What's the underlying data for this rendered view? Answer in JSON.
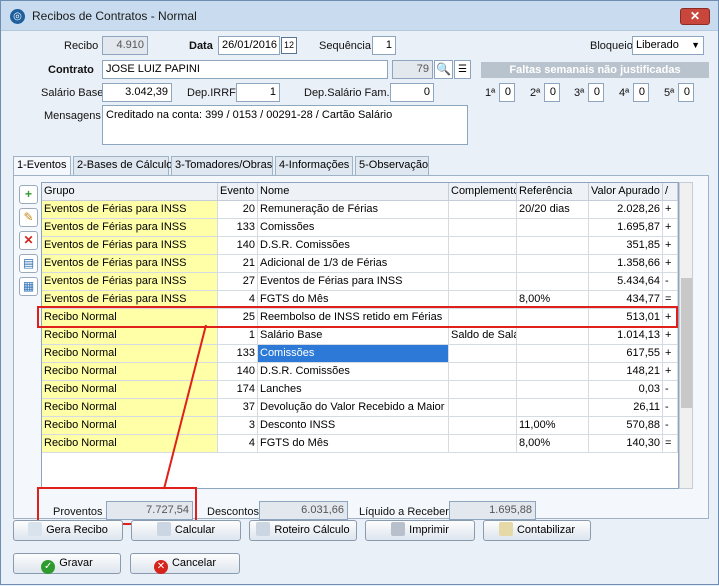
{
  "window": {
    "title": "Recibos de Contratos - Normal",
    "close_label": "✕"
  },
  "form": {
    "recibo_label": "Recibo",
    "recibo_value": "4.910",
    "data_label": "Data",
    "data_value": "26/01/2016",
    "sequencia_label": "Sequência",
    "sequencia_value": "1",
    "bloqueio_label": "Bloqueio",
    "bloqueio_value": "Liberado",
    "contrato_label": "Contrato",
    "contrato_value": "JOSE LUIZ PAPINI",
    "contrato_code": "79",
    "faltas_title": "Faltas semanais não justificadas",
    "salario_label": "Salário Base",
    "salario_value": "3.042,39",
    "depirrf_label": "Dep.IRRF",
    "depirrf_value": "1",
    "depsal_label": "Dep.Salário Fam.",
    "depsal_value": "0",
    "faltas": [
      {
        "label": "1ª",
        "value": "0"
      },
      {
        "label": "2ª",
        "value": "0"
      },
      {
        "label": "3ª",
        "value": "0"
      },
      {
        "label": "4ª",
        "value": "0"
      },
      {
        "label": "5ª",
        "value": "0"
      }
    ],
    "mensagens_label": "Mensagens",
    "mensagens_value": "Creditado na conta: 399 / 0153 / 00291-28 / Cartão Salário"
  },
  "tabs": [
    "1-Eventos",
    "2-Bases de Cálculo",
    "3-Tomadores/Obras",
    "4-Informações",
    "5-Observação"
  ],
  "grid": {
    "headers": [
      "Grupo",
      "Evento",
      "Nome",
      "Complemento",
      "Referência",
      "Valor Apurado",
      "/"
    ],
    "rows": [
      {
        "grupo": "Eventos de Férias para INSS",
        "evento": "20",
        "nome": "Remuneração de Férias",
        "comp": "",
        "ref": "20/20 dias",
        "valor": "2.028,26",
        "sinal": "+"
      },
      {
        "grupo": "Eventos de Férias para INSS",
        "evento": "133",
        "nome": "Comissões",
        "comp": "",
        "ref": "",
        "valor": "1.695,87",
        "sinal": "+"
      },
      {
        "grupo": "Eventos de Férias para INSS",
        "evento": "140",
        "nome": "D.S.R. Comissões",
        "comp": "",
        "ref": "",
        "valor": "351,85",
        "sinal": "+"
      },
      {
        "grupo": "Eventos de Férias para INSS",
        "evento": "21",
        "nome": "Adicional de 1/3 de Férias",
        "comp": "",
        "ref": "",
        "valor": "1.358,66",
        "sinal": "+"
      },
      {
        "grupo": "Eventos de Férias para INSS",
        "evento": "27",
        "nome": "Eventos de Férias para INSS",
        "comp": "",
        "ref": "",
        "valor": "5.434,64",
        "sinal": "-"
      },
      {
        "grupo": "Eventos de Férias para INSS",
        "evento": "4",
        "nome": "FGTS do Mês",
        "comp": "",
        "ref": "8,00%",
        "valor": "434,77",
        "sinal": "="
      },
      {
        "grupo": "Recibo Normal",
        "evento": "25",
        "nome": "Reembolso de INSS retido em Férias",
        "comp": "",
        "ref": "",
        "valor": "513,01",
        "sinal": "+"
      },
      {
        "grupo": "Recibo Normal",
        "evento": "1",
        "nome": "Salário Base",
        "comp": "Saldo de Salári",
        "ref": "",
        "valor": "1.014,13",
        "sinal": "+"
      },
      {
        "grupo": "Recibo Normal",
        "evento": "133",
        "nome": "Comissões",
        "comp": "",
        "ref": "",
        "valor": "617,55",
        "sinal": "+"
      },
      {
        "grupo": "Recibo Normal",
        "evento": "140",
        "nome": "D.S.R. Comissões",
        "comp": "",
        "ref": "",
        "valor": "148,21",
        "sinal": "+"
      },
      {
        "grupo": "Recibo Normal",
        "evento": "174",
        "nome": "Lanches",
        "comp": "",
        "ref": "",
        "valor": "0,03",
        "sinal": "-"
      },
      {
        "grupo": "Recibo Normal",
        "evento": "37",
        "nome": "Devolução do Valor Recebido a Maior em",
        "comp": "",
        "ref": "",
        "valor": "26,11",
        "sinal": "-"
      },
      {
        "grupo": "Recibo Normal",
        "evento": "3",
        "nome": "Desconto INSS",
        "comp": "",
        "ref": "11,00%",
        "valor": "570,88",
        "sinal": "-"
      },
      {
        "grupo": "Recibo Normal",
        "evento": "4",
        "nome": "FGTS do Mês",
        "comp": "",
        "ref": "8,00%",
        "valor": "140,30",
        "sinal": "="
      }
    ]
  },
  "totals": {
    "proventos_label": "Proventos",
    "proventos_value": "7.727,54",
    "descontos_label": "Descontos",
    "descontos_value": "6.031,66",
    "liquido_label": "Líquido a Receber",
    "liquido_value": "1.695,88"
  },
  "buttons": {
    "gera_recibo": "Gera Recibo",
    "calcular": "Calcular",
    "roteiro": "Roteiro Cálculo",
    "imprimir": "Imprimir",
    "contabilizar": "Contabilizar",
    "gravar": "Gravar",
    "cancelar": "Cancelar"
  },
  "colors": {
    "highlight": "#e0201b",
    "group_cell": "#ffffa8",
    "selection": "#2d79d8"
  }
}
